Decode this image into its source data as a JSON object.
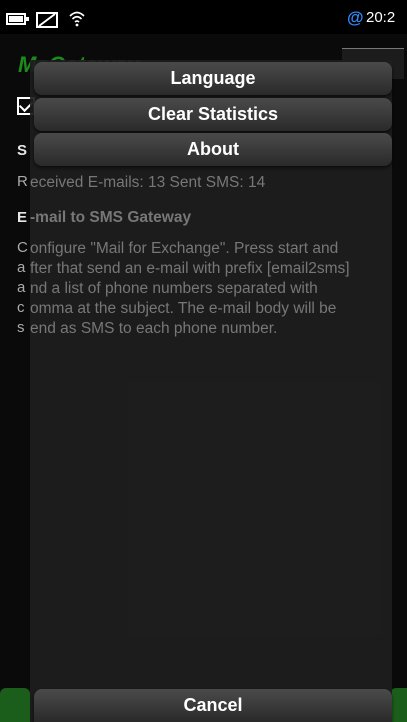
{
  "status_bar": {
    "battery_icon": "battery-icon",
    "sim_icon": "sim-card-icon",
    "wifi_icon": "wifi-icon",
    "notification": "@",
    "notification_color": "#2e8bff",
    "time": "20:2"
  },
  "app": {
    "title": "MaGateway",
    "title_color": "#1d8a1d",
    "stats_heading_initial": "S",
    "stats_text_initial": "R",
    "stats_text_rest": "eceived E-mails: 13 Sent SMS: 14",
    "gateway_heading_initial": "E",
    "gateway_heading_rest": "-mail to SMS Gateway",
    "description_initials": [
      "C",
      "a",
      "a",
      "c",
      "s"
    ],
    "description_lines": [
      "onfigure \"Mail for Exchange\". Press start and",
      "fter that send an e-mail with prefix [email2sms]",
      "nd a list of phone numbers separated with",
      "omma at the subject. The e-mail body will be",
      "end as SMS to each phone number."
    ]
  },
  "menu": {
    "items": [
      {
        "label": "Language"
      },
      {
        "label": "Clear Statistics"
      },
      {
        "label": "About"
      }
    ],
    "cancel_label": "Cancel"
  }
}
